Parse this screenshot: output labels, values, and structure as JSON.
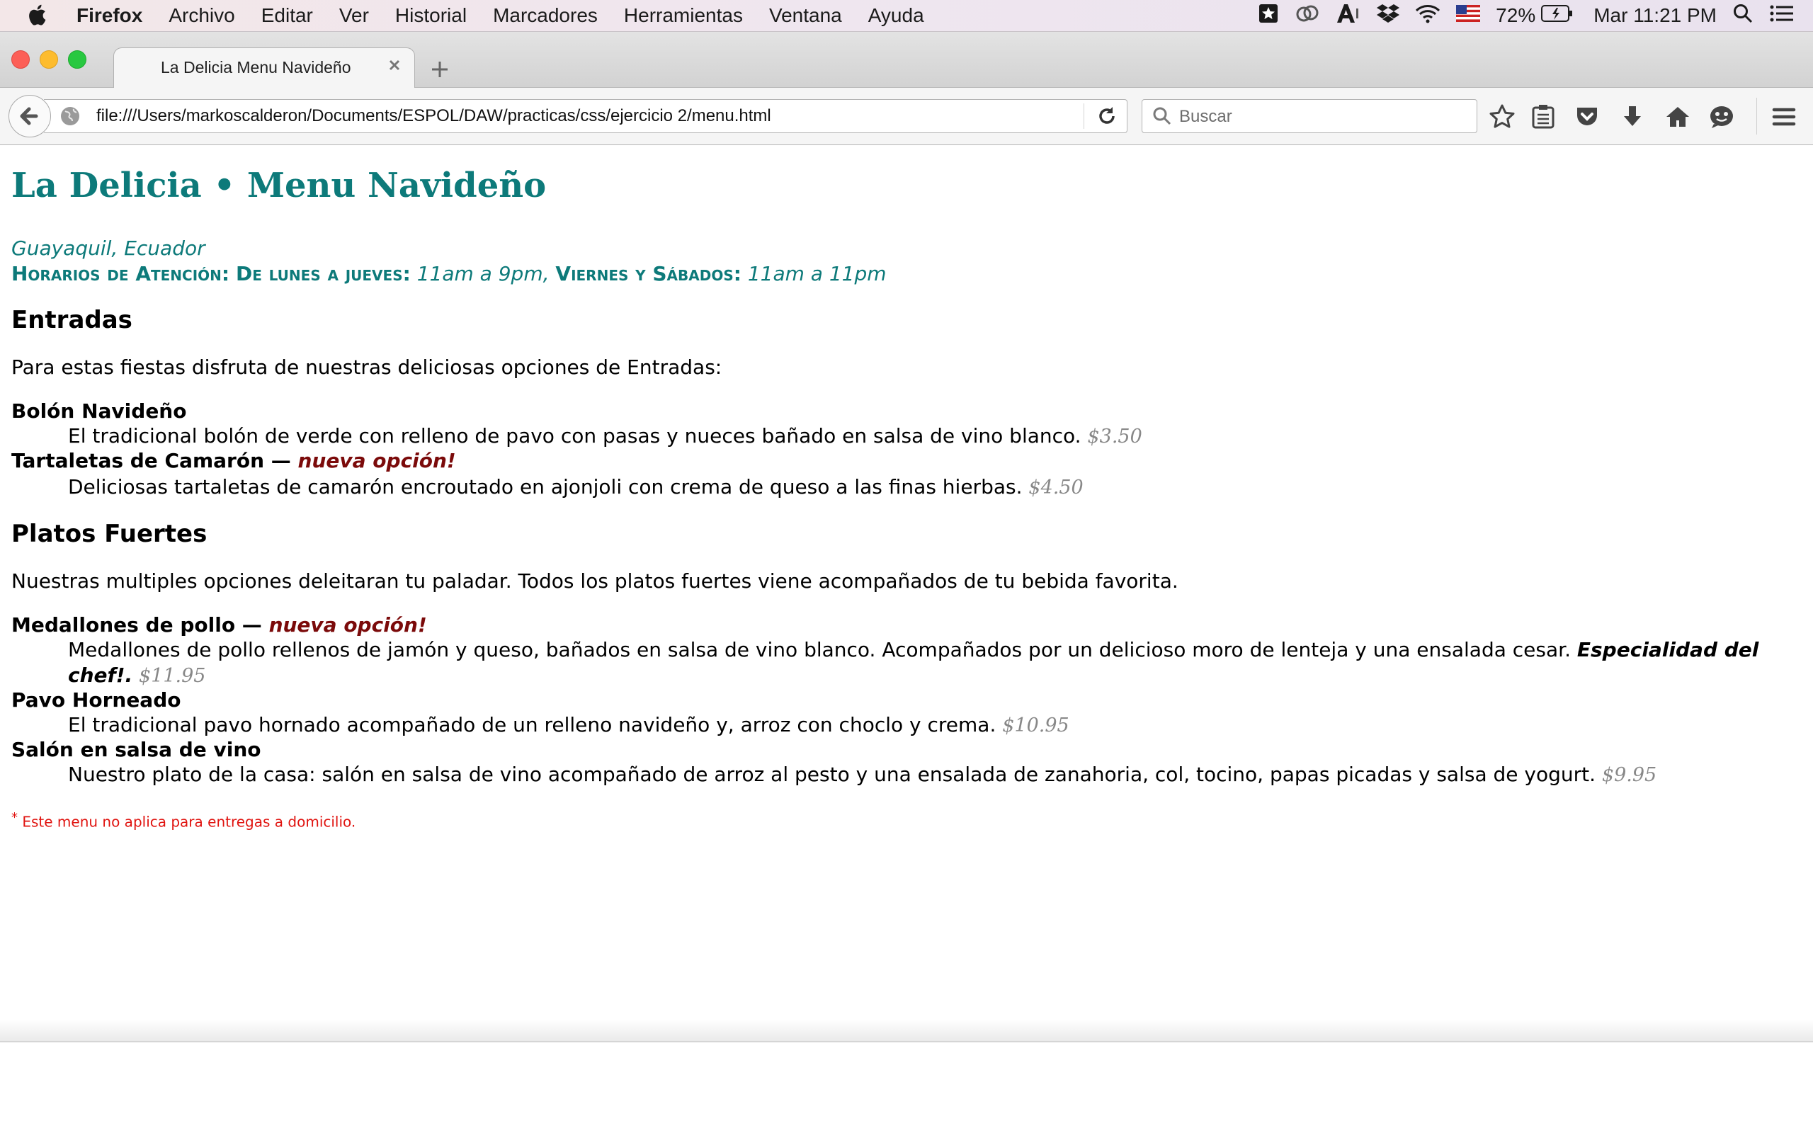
{
  "menubar": {
    "app_name": "Firefox",
    "items": [
      "Archivo",
      "Editar",
      "Ver",
      "Historial",
      "Marcadores",
      "Herramientas",
      "Ventana",
      "Ayuda"
    ],
    "battery": "72%",
    "clock": "Mar 11:21 PM",
    "status_icons": [
      "bookmark-app-icon",
      "creative-cloud-icon",
      "adobe-icon",
      "dropbox-icon",
      "wifi-icon",
      "us-flag-icon",
      "battery-icon",
      "spotlight-search-icon",
      "notification-center-icon"
    ]
  },
  "browser": {
    "tab_title": "La Delicia Menu Navideño",
    "url": "file:///Users/markoscalderon/Documents/ESPOL/DAW/practicas/css/ejercicio 2/menu.html",
    "search_placeholder": "Buscar",
    "toolbar_icons": [
      "star-icon",
      "reading-list-icon",
      "pocket-icon",
      "download-icon",
      "home-icon",
      "chat-icon",
      "hamburger-menu-icon"
    ]
  },
  "page": {
    "title": "La Delicia • Menu Navideño",
    "location": "Guayaquil, Ecuador",
    "hours": {
      "label": "Horarios de Atención:",
      "weekday_label": "De lunes a jueves:",
      "weekday_hours": "11am a 9pm",
      "weekend_label": "Viernes y Sábados:",
      "weekend_hours": "11am a 11pm"
    },
    "sections": [
      {
        "heading": "Entradas",
        "intro": "Para estas fiestas disfruta de nuestras deliciosas opciones de Entradas:",
        "items": [
          {
            "name": "Bolón Navideño",
            "description": "El tradicional bolón de verde con relleno de pavo con pasas y nueces bañado en salsa de vino blanco.",
            "price": "$3.50"
          },
          {
            "name": "Tartaletas de Camarón —",
            "tag": "nueva opción!",
            "description": "Deliciosas tartaletas de camarón encroutado en ajonjoli con crema de queso a las finas hierbas.",
            "price": "$4.50"
          }
        ]
      },
      {
        "heading": "Platos Fuertes",
        "intro": "Nuestras multiples opciones deleitaran tu paladar. Todos los platos fuertes viene acompañados de tu bebida favorita.",
        "items": [
          {
            "name": "Medallones de pollo —",
            "tag": "nueva opción!",
            "description": "Medallones de pollo rellenos de jamón y queso, bañados en salsa de vino blanco. Acompañados por un delicioso moro de lenteja y una ensalada cesar.",
            "special": "Especialidad del chef!.",
            "price": "$11.95"
          },
          {
            "name": "Pavo Horneado",
            "description": "El tradicional pavo hornado acompañado de un relleno navideño y, arroz con choclo y crema.",
            "price": "$10.95"
          },
          {
            "name": "Salón en salsa de vino",
            "description": "Nuestro plato de la casa: salón en salsa de vino acompañado de arroz al pesto y una ensalada de zanahoria, col, tocino, papas picadas y salsa de yogurt.",
            "price": "$9.95"
          }
        ]
      }
    ],
    "footnote_mark": "*",
    "footnote": "Este menu no aplica para entregas a domicilio."
  },
  "colors": {
    "accent_teal": "#0d7a7a",
    "new_tag": "#7b0a0a",
    "price_gray": "#888888",
    "footnote_red": "#e0130f"
  }
}
